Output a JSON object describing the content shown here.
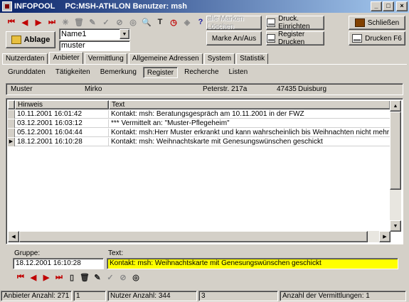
{
  "window": {
    "app_name": "INFOPOOL",
    "context": "PC:MSH-ATHLON Benutzer: msh"
  },
  "toolbar": {
    "nav_icons": [
      {
        "name": "first-record-icon",
        "glyph": "⏮",
        "color": "red"
      },
      {
        "name": "previous-record-icon",
        "glyph": "◀",
        "color": "red"
      },
      {
        "name": "next-record-icon",
        "glyph": "▶",
        "color": "red"
      },
      {
        "name": "last-record-icon",
        "glyph": "⏭",
        "color": "red"
      },
      {
        "name": "new-record-icon",
        "glyph": "✳",
        "color": "gray"
      },
      {
        "name": "delete-record-icon",
        "glyph": "🗑",
        "color": "gray"
      },
      {
        "name": "edit-record-icon",
        "glyph": "✎",
        "color": "gray"
      },
      {
        "name": "post-record-icon",
        "glyph": "✓",
        "color": "gray"
      },
      {
        "name": "cancel-edit-icon",
        "glyph": "⊘",
        "color": "gray"
      },
      {
        "name": "refresh-icon",
        "glyph": "◎",
        "color": "gray"
      },
      {
        "name": "search-icon",
        "glyph": "🔍",
        "color": "gray"
      },
      {
        "name": "text-icon",
        "glyph": "T",
        "color": "dark"
      },
      {
        "name": "clock-icon",
        "glyph": "◷",
        "color": "red"
      },
      {
        "name": "tag-icon",
        "glyph": "◈",
        "color": "gray"
      },
      {
        "name": "help-icon",
        "glyph": "?",
        "color": "blue"
      }
    ],
    "ablage_label": "Ablage",
    "name_select_value": "Name1",
    "search_value": "muster",
    "alle_marken_label": "alle Marken Löschen",
    "marke_label": "Marke An/Aus",
    "druck_einrichten_label": "Druck. Einrichten",
    "register_drucken_label": "Register Drucken",
    "schliessen_label": "Schließen",
    "drucken_f6_label": "Drucken F6"
  },
  "tabs": [
    {
      "label": "Nutzerdaten",
      "active": false
    },
    {
      "label": "Anbieter",
      "active": true
    },
    {
      "label": "Vermittlung",
      "active": false
    },
    {
      "label": "Allgemeine Adressen",
      "active": false
    },
    {
      "label": "System",
      "active": false
    },
    {
      "label": "Statistik",
      "active": false
    }
  ],
  "subtabs": [
    {
      "label": "Grunddaten",
      "active": false
    },
    {
      "label": "Tätigkeiten",
      "active": false
    },
    {
      "label": "Bemerkung",
      "active": false
    },
    {
      "label": "Register",
      "active": true
    },
    {
      "label": "Recherche",
      "active": false
    },
    {
      "label": "Listen",
      "active": false
    }
  ],
  "record": {
    "lastname": "Muster",
    "firstname": "Mirko",
    "street": "Peterstr. 217a",
    "zip": "47435",
    "city": "Duisburg"
  },
  "grid": {
    "columns": [
      "Hinweis",
      "Text"
    ],
    "rows": [
      {
        "hinweis": "10.11.2001 16:01:42",
        "text": "Kontakt: msh: Beratungsgespräch am 10.11.2001 in der FWZ",
        "current": false
      },
      {
        "hinweis": "03.12.2001 16:03:12",
        "text": "*** Vermittelt an: \"Muster-Pflegeheim\"",
        "current": false
      },
      {
        "hinweis": "05.12.2001 16:04:44",
        "text": "Kontakt: msh:Herr Muster erkrankt und kann wahrscheinlich bis Weihnachten nicht mehr arbeiten",
        "current": false
      },
      {
        "hinweis": "18.12.2001 16:10:28",
        "text": "Kontakt: msh: Weihnachtskarte mit Genesungswünschen geschickt",
        "current": true
      }
    ]
  },
  "detail": {
    "gruppe_label": "Gruppe:",
    "text_label": "Text:",
    "gruppe_value": "18.12.2001 16:10:28",
    "text_value": "Kontakt: msh: Weihnachtskarte mit Genesungswünschen geschickt",
    "icons": [
      {
        "name": "first-record-icon",
        "glyph": "⏮",
        "color": "red"
      },
      {
        "name": "previous-record-icon",
        "glyph": "◀",
        "color": "red"
      },
      {
        "name": "next-record-icon",
        "glyph": "▶",
        "color": "red"
      },
      {
        "name": "last-record-icon",
        "glyph": "⏭",
        "color": "red"
      },
      {
        "name": "new-document-icon",
        "glyph": "▯",
        "color": "dark"
      },
      {
        "name": "delete-record-icon",
        "glyph": "🗑",
        "color": "dark"
      },
      {
        "name": "edit-record-icon",
        "glyph": "✎",
        "color": "dark"
      },
      {
        "name": "post-record-icon",
        "glyph": "✓",
        "color": "gray"
      },
      {
        "name": "cancel-edit-icon",
        "glyph": "⊘",
        "color": "gray"
      },
      {
        "name": "refresh-icon",
        "glyph": "◎",
        "color": "dark"
      }
    ]
  },
  "status": {
    "anbieter_label": "Anbieter Anzahl:",
    "anbieter_count": "271",
    "anbieter_pos": "1",
    "nutzer_label": "Nutzer Anzahl:",
    "nutzer_count": "344",
    "nutzer_pos": "3",
    "vermittlungen_label": "Anzahl der Vermittlungen:",
    "vermittlungen_count": "1"
  },
  "colors": {
    "title_active": "#0a246a",
    "highlight_field": "#ffff00",
    "nav_arrow": "#c00000"
  }
}
